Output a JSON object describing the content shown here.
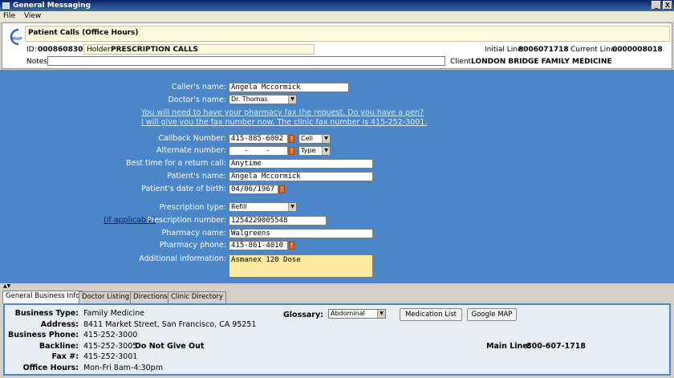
{
  "window": {
    "title": "General Messaging",
    "minimize": "_",
    "close": "X"
  },
  "menu": [
    "File",
    "View"
  ],
  "header": {
    "logo_text": "MAP",
    "call_type": "Patient Calls (Office Hours)",
    "id_label": "ID:",
    "id_value": "0008608300",
    "holder_label": "Holder:",
    "holder_value": "PRESCRIPTION CALLS",
    "initial_line_label": "Initial Line:",
    "initial_line_value": "8006071718",
    "current_line_label": "Current Line:",
    "current_line_value": "0000008018",
    "notes_label": "Notes:",
    "notes_value": "",
    "client_label": "Client:",
    "client_value": "LONDON BRIDGE FAMILY MEDICINE"
  },
  "form": {
    "callers_name_label": "Caller's name:",
    "callers_name": "Angela Mccormick",
    "doctors_name_label": "Doctor's name:",
    "doctors_name": "Dr. Thomas",
    "script_line1": "You will need to have your pharmacy fax the request.  Do you have a pen?",
    "script_line2": "I will give you the fax number now. The clinic fax number is 415-252-3001.",
    "callback_label": "Callback Number:",
    "callback_number": "415-885-6002",
    "callback_type": "Cell",
    "alternate_label": "Alternate number:",
    "alternate_number": "   -    -    ",
    "alternate_type": "Type",
    "best_time_label": "Best time for a return call:",
    "best_time": "Anytime",
    "patients_name_label": "Patient's name:",
    "patients_name": "Angela Mccormick",
    "dob_label": "Patient's date of birth:",
    "dob": "04/06/1967",
    "rx_type_label": "Prescription type:",
    "rx_type": "Refill",
    "if_applicable": "(if applicable)",
    "rx_number_label": "Prescription number:",
    "rx_number": "1254229005548",
    "pharmacy_name_label": "Pharmacy name:",
    "pharmacy_name": "Walgreens",
    "pharmacy_phone_label": "Pharmacy phone:",
    "pharmacy_phone": "415-861-4010",
    "additional_label": "Additional information:",
    "additional": "Asmanex 120 Dose",
    "flag_glyph": "!"
  },
  "tabs": [
    "General Business Info",
    "Doctor Listing",
    "Directions",
    "Clinic Directory"
  ],
  "business": {
    "type_label": "Business Type:",
    "type": "Family Medicine",
    "address_label": "Address:",
    "address": "8411 Market Street, San Francisco, CA 95251",
    "phone_label": "Business Phone:",
    "phone": "415-252-3000",
    "backline_label": "Backline:",
    "backline": "415-252-3005",
    "backline_note": "Do Not Give Out",
    "fax_label": "Fax #:",
    "fax": "415-252-3001",
    "hours_label": "Office Hours:",
    "hours": "Mon-Fri 8am-4:30pm",
    "glossary_label": "Glossary:",
    "glossary_value": "Abdominal",
    "medication_list": "Medication List",
    "google_map": "Google MAP",
    "main_line_label": "Main Line:",
    "main_line": "800-607-1718"
  },
  "colors": {
    "form_bg": "#4a86c8",
    "title_bg": "#0a246a",
    "flag": "#e07020",
    "note_yellow": "#fff6b0"
  }
}
